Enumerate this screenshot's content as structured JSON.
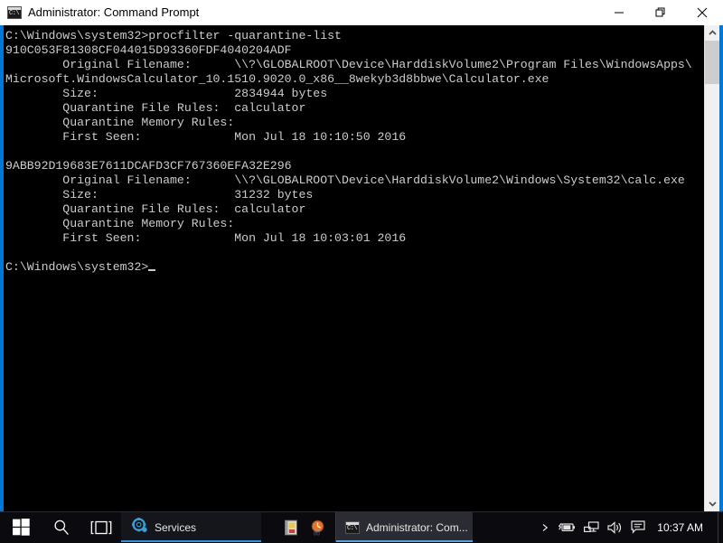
{
  "window": {
    "title": "Administrator: Command Prompt",
    "icon": "cmd-icon",
    "icon_glyph": "C:\\",
    "controls": {
      "minimize": "minimize",
      "restore": "restore",
      "close": "close"
    },
    "accent_color": "#0078d7"
  },
  "terminal": {
    "background": "#000000",
    "foreground": "#cccccc",
    "lines": [
      "C:\\Windows\\system32>procfilter -quarantine-list",
      "910C053F81308CF044015D93360FDF4040204ADF",
      "        Original Filename:      \\\\?\\GLOBALROOT\\Device\\HarddiskVolume2\\Program Files\\WindowsApps\\",
      "Microsoft.WindowsCalculator_10.1510.9020.0_x86__8wekyb3d8bbwe\\Calculator.exe",
      "        Size:                   2834944 bytes",
      "        Quarantine File Rules:  calculator",
      "        Quarantine Memory Rules:",
      "        First Seen:             Mon Jul 18 10:10:50 2016",
      "",
      "9ABB92D19683E7611DCAFD3CF767360EFA32E296",
      "        Original Filename:      \\\\?\\GLOBALROOT\\Device\\HarddiskVolume2\\Windows\\System32\\calc.exe",
      "        Size:                   31232 bytes",
      "        Quarantine File Rules:  calculator",
      "        Quarantine Memory Rules:",
      "        First Seen:             Mon Jul 18 10:03:01 2016",
      "",
      "C:\\Windows\\system32>"
    ],
    "command": "procfilter -quarantine-list",
    "prompt": "C:\\Windows\\system32>",
    "entries": [
      {
        "hash": "910C053F81308CF044015D93360FDF4040204ADF",
        "original_filename": "\\\\?\\GLOBALROOT\\Device\\HarddiskVolume2\\Program Files\\WindowsApps\\Microsoft.WindowsCalculator_10.1510.9020.0_x86__8wekyb3d8bbwe\\Calculator.exe",
        "size": "2834944 bytes",
        "quarantine_file_rules": "calculator",
        "quarantine_memory_rules": "",
        "first_seen": "Mon Jul 18 10:10:50 2016"
      },
      {
        "hash": "9ABB92D19683E7611DCAFD3CF767360EFA32E296",
        "original_filename": "\\\\?\\GLOBALROOT\\Device\\HarddiskVolume2\\Windows\\System32\\calc.exe",
        "size": "31232 bytes",
        "quarantine_file_rules": "calculator",
        "quarantine_memory_rules": "",
        "first_seen": "Mon Jul 18 10:03:01 2016"
      }
    ],
    "labels": {
      "original_filename": "Original Filename:",
      "size": "Size:",
      "quarantine_file_rules": "Quarantine File Rules:",
      "quarantine_memory_rules": "Quarantine Memory Rules:",
      "first_seen": "First Seen:"
    }
  },
  "scrollbar": {
    "up_arrow": "chevron-up-icon",
    "down_arrow": "chevron-down-icon"
  },
  "taskbar": {
    "start": "windows-logo-icon",
    "search": "search-icon",
    "taskview": "task-view-icon",
    "services": {
      "label": "Services",
      "icon": "gear-icon"
    },
    "pinned": [
      {
        "name": "notepad-document-icon"
      },
      {
        "name": "clock-badge-icon"
      }
    ],
    "active_window": {
      "label": "Administrator: Com...",
      "icon": "cmd-icon"
    },
    "tray": [
      {
        "name": "show-hidden-icons-icon"
      },
      {
        "name": "battery-icon"
      },
      {
        "name": "network-icon"
      },
      {
        "name": "volume-icon"
      },
      {
        "name": "action-center-icon"
      }
    ],
    "clock": "10:37 AM"
  }
}
